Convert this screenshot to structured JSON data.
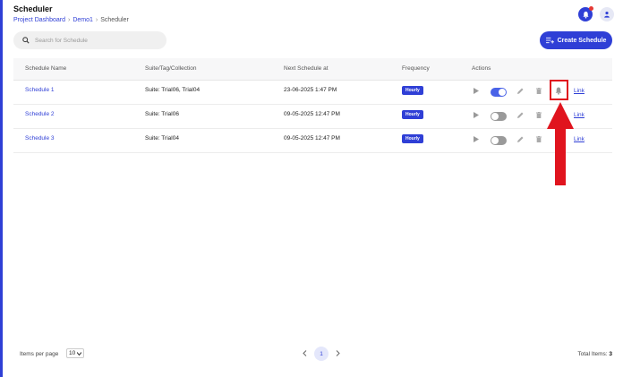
{
  "header": {
    "title": "Scheduler",
    "breadcrumb": [
      "Project Dashboard",
      "Demo1",
      "Scheduler"
    ]
  },
  "search": {
    "placeholder": "Search for Schedule"
  },
  "create_button": {
    "label": "Create Schedule"
  },
  "table": {
    "columns": [
      "Schedule Name",
      "Suite/Tag/Collection",
      "Next Schedule at",
      "Frequency",
      "Actions"
    ],
    "rows": [
      {
        "name": "Schedule 1",
        "suite": "Suite: Trial06, Trial04",
        "next": "23-06-2025 1:47 PM",
        "frequency": "Hourly",
        "enabled": true,
        "link": "Link"
      },
      {
        "name": "Schedule 2",
        "suite": "Suite: Trial06",
        "next": "09-05-2025 12:47 PM",
        "frequency": "Hourly",
        "enabled": false,
        "link": "Link"
      },
      {
        "name": "Schedule 3",
        "suite": "Suite: Trial04",
        "next": "09-05-2025 12:47 PM",
        "frequency": "Hourly",
        "enabled": false,
        "link": "Link"
      }
    ]
  },
  "footer": {
    "items_per_page_label": "Items per page",
    "items_per_page": "10",
    "current_page": "1",
    "total_label": "Total Items:",
    "total_value": "3"
  },
  "colors": {
    "accent": "#2f3fd6",
    "annotation": "#e0141e"
  }
}
